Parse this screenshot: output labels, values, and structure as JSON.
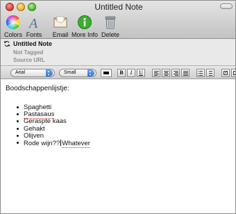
{
  "window": {
    "title": "Untitled Note"
  },
  "toolbar": {
    "items": [
      {
        "label": "Colors",
        "icon": "color-wheel-icon"
      },
      {
        "label": "Fonts",
        "icon": "font-icon"
      },
      {
        "label": "Email",
        "icon": "envelope-icon"
      },
      {
        "label": "More Info",
        "icon": "info-icon"
      },
      {
        "label": "Delete",
        "icon": "trash-icon"
      }
    ]
  },
  "note": {
    "title": "Untitled Note",
    "tags": "Not Tagged",
    "source": "Source URL"
  },
  "format_bar": {
    "font": "Arial",
    "size": "Small",
    "text_color": "#000000",
    "bold": "B",
    "italic": "I",
    "underline": "U"
  },
  "content": {
    "heading": "Boodschappenlijstje:",
    "items": [
      "Spaghetti",
      "Pastasaus",
      "Geraspte kaas",
      "Gehakt",
      "Olijven"
    ],
    "last_item_before_caret": "Rode wijn??",
    "last_item_after_caret": "Whatever"
  },
  "colors": {
    "accent": "#2f6fd6",
    "toolbar_top": "#e4e4e4",
    "toolbar_bottom": "#c2c2c2",
    "meta_bg": "#e9e9e9",
    "muted_text": "#8e8e8e"
  }
}
